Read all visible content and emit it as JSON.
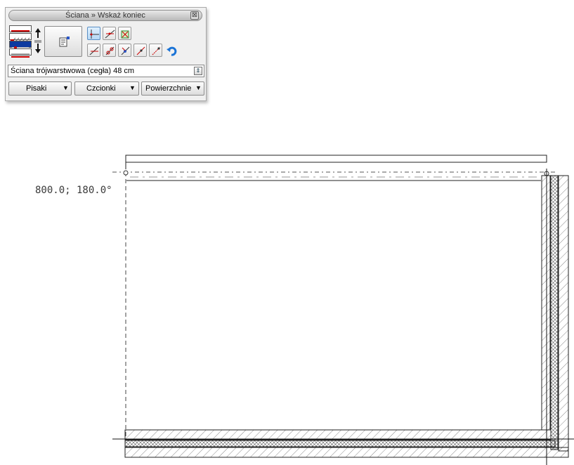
{
  "panel": {
    "title": "Ściana » Wskaż koniec",
    "close_glyph": "⊠",
    "wall_type": "Ściana trójwarstwowa (cegła) 48 cm",
    "buttons": {
      "pens": "Pisaki",
      "fonts": "Czcionki",
      "surfaces": "Powierzchnie"
    },
    "dropdown_arrow": "▼",
    "tool_icons": [
      "perpendicular-point-icon",
      "cancel-point-icon",
      "extend-icon",
      "trim-icon",
      "node-edit-icon",
      "split-icon",
      "offset-icon",
      "line-point-icon",
      "undo-icon"
    ]
  },
  "canvas": {
    "coordinate_readout": "800.0;  180.0°"
  }
}
